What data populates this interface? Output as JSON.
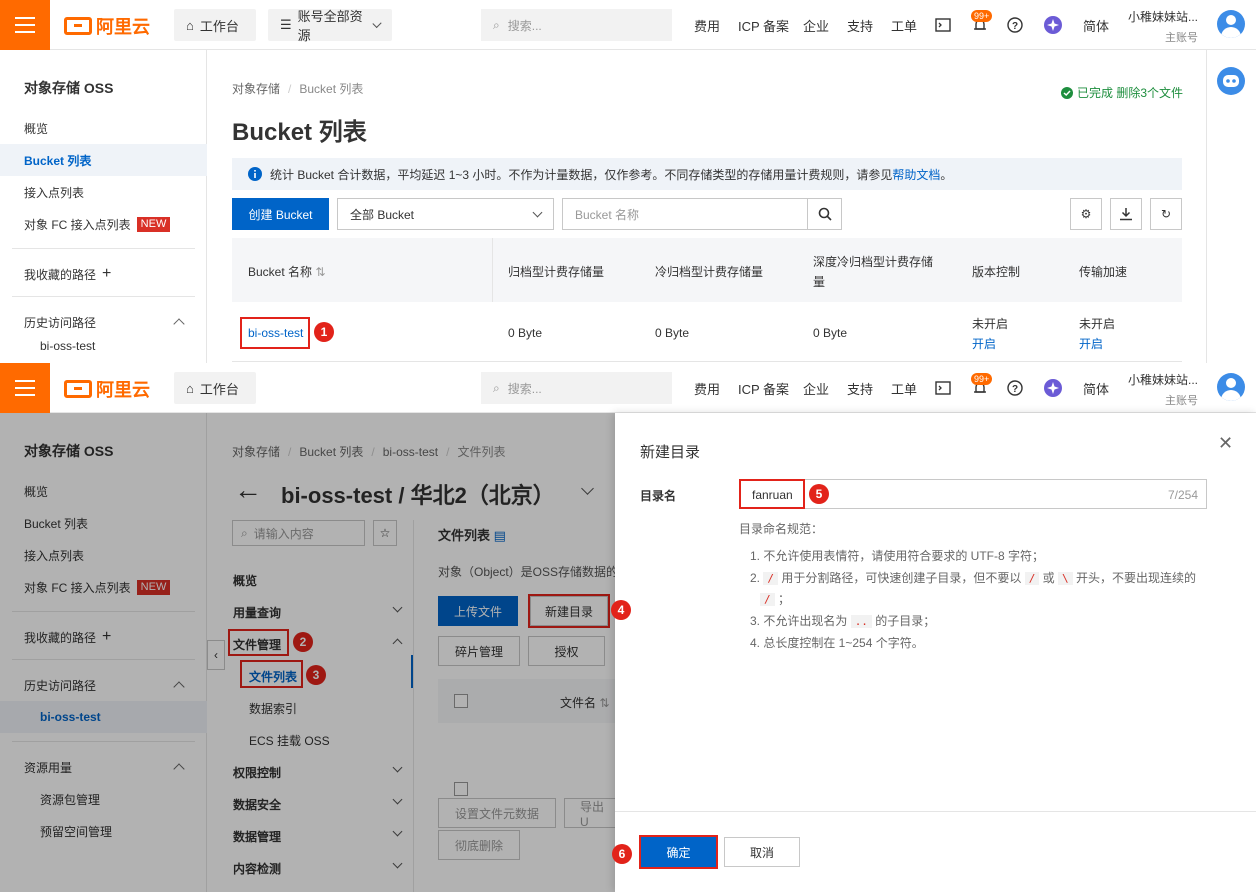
{
  "topbar": {
    "logo": "阿里云",
    "workbench": "工作台",
    "account_resources": "账号全部资源",
    "search_placeholder": "搜索...",
    "nav": [
      "费用",
      "ICP 备案",
      "企业",
      "支持",
      "工单"
    ],
    "badge": "99+",
    "lang": "简体",
    "user_name": "小稚妹妹站...",
    "user_role": "主账号"
  },
  "top_sidebar": {
    "title": "对象存储 OSS",
    "items": [
      "概览",
      "Bucket 列表",
      "接入点列表",
      "对象 FC 接入点列表"
    ],
    "new_badge": "NEW",
    "favorites": "我收藏的路径",
    "history": "历史访问路径",
    "history_item": "bi-oss-test"
  },
  "top_main": {
    "breadcrumb": [
      "对象存储",
      "Bucket 列表"
    ],
    "status": "已完成 删除3个文件",
    "title": "Bucket 列表",
    "notice": "统计 Bucket 合计数据，平均延迟 1~3 小时。不作为计量数据，仅作参考。不同存储类型的存储用量计费规则，请参见",
    "notice_link": "帮助文档",
    "notice_end": "。",
    "create_button": "创建 Bucket",
    "filter_select": "全部 Bucket",
    "bucket_search_placeholder": "Bucket 名称",
    "columns": [
      "Bucket 名称",
      "归档型计费存储量",
      "冷归档型计费存储量",
      "深度冷归档型计费存储量",
      "版本控制",
      "传输加速"
    ],
    "row": {
      "name": "bi-oss-test",
      "archive": "0 Byte",
      "cold": "0 Byte",
      "deep": "0 Byte",
      "versioning": "未开启",
      "versioning_action": "开启",
      "accel": "未开启",
      "accel_action": "开启"
    }
  },
  "bottom_sidebar": {
    "title": "对象存储 OSS",
    "items": [
      "概览",
      "Bucket 列表",
      "接入点列表",
      "对象 FC 接入点列表"
    ],
    "new_badge": "NEW",
    "favorites": "我收藏的路径",
    "history": "历史访问路径",
    "history_item": "bi-oss-test",
    "resource": "资源用量",
    "resource_items": [
      "资源包管理",
      "预留空间管理"
    ]
  },
  "bottom_main": {
    "breadcrumb": [
      "对象存储",
      "Bucket 列表",
      "bi-oss-test",
      "文件列表"
    ],
    "title": "bi-oss-test / 华北2（北京）",
    "nav_search_placeholder": "请输入内容",
    "nav_items": [
      "概览",
      "用量查询",
      "文件管理",
      "文件列表",
      "数据索引",
      "ECS 挂载 OSS",
      "权限控制",
      "数据安全",
      "数据管理",
      "内容检测"
    ],
    "file_list_title": "文件列表",
    "desc": "对象（Object）是OSS存储数据的",
    "upload_button": "上传文件",
    "new_dir_button": "新建目录",
    "fragment_button": "碎片管理",
    "auth_button": "授权",
    "col_filename": "文件名",
    "meta_button": "设置文件元数据",
    "export_button": "导出 U",
    "delete_button": "彻底删除"
  },
  "dialog": {
    "title": "新建目录",
    "label": "目录名",
    "value": "fanruan",
    "count": "7/254",
    "rules_title": "目录命名规范：",
    "rule1": "1. 不允许使用表情符，请使用符合要求的 UTF-8 字符；",
    "rule2_a": "2.",
    "rule2_code1": "/",
    "rule2_b": "用于分割路径，可快速创建子目录，但不要以",
    "rule2_code2": "/",
    "rule2_c": "或",
    "rule2_code3": "\\",
    "rule2_d": "开头，不要出现连续的",
    "rule2_code4": "/",
    "rule2_e": "；",
    "rule3_a": "3. 不允许出现名为",
    "rule3_code": "..",
    "rule3_b": "的子目录；",
    "rule4": "4. 总长度控制在 1~254 个字符。",
    "confirm": "确定",
    "cancel": "取消"
  },
  "step_numbers": [
    "1",
    "2",
    "3",
    "4",
    "5",
    "6"
  ],
  "colors": {
    "brand": "#ff6a00",
    "primary": "#0064c8",
    "annotation": "#e2231a"
  }
}
